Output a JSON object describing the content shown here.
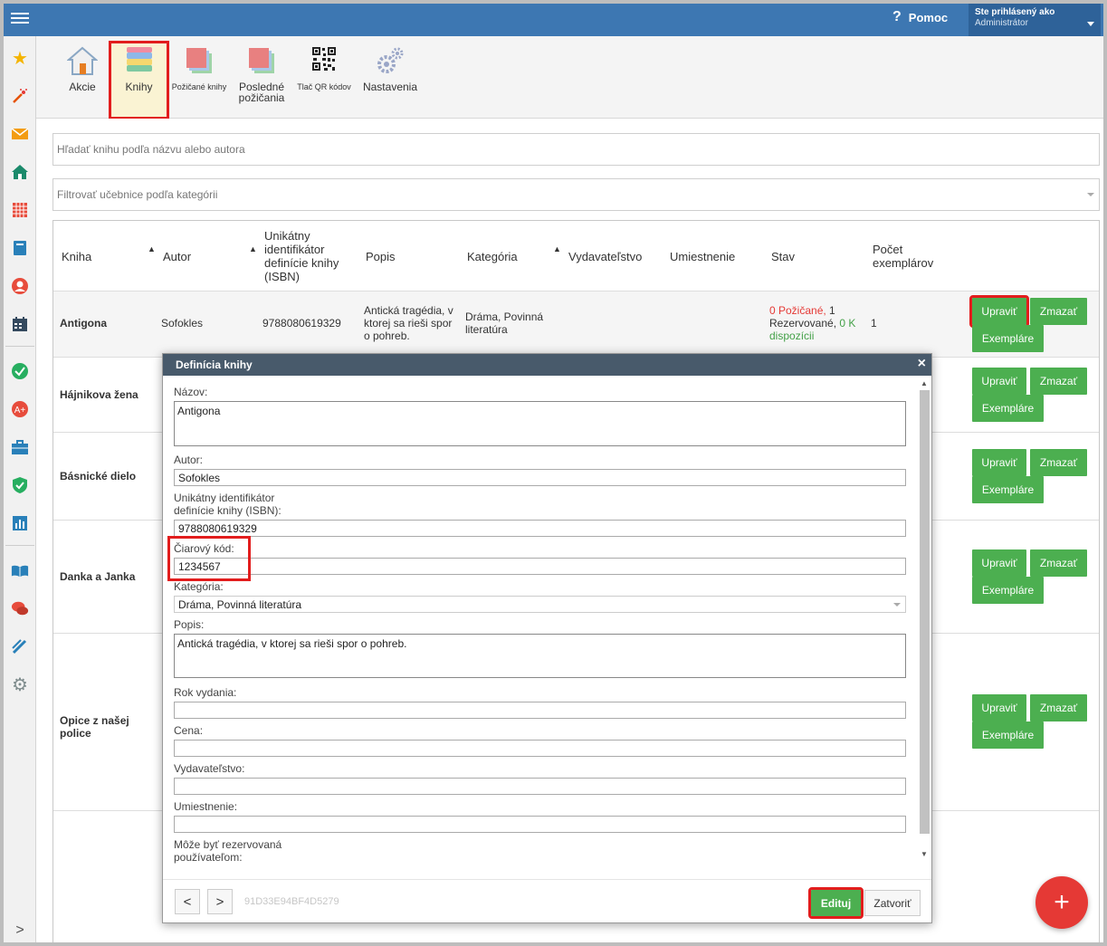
{
  "topbar": {
    "help_label": "Pomoc",
    "help_icon": "?",
    "user_line1": "Ste prihlásený ako",
    "user_line2": "Administrátor"
  },
  "ribbon": [
    {
      "label": "Akcie"
    },
    {
      "label": "Knihy"
    },
    {
      "label": "Požičané knihy"
    },
    {
      "label_line1": "Posledné",
      "label_line2": "požičania"
    },
    {
      "label": "Tlač QR kódov"
    },
    {
      "label": "Nastavenia"
    }
  ],
  "search": {
    "placeholder": "Hľadať knihu podľa názvu alebo autora"
  },
  "category_filter": {
    "placeholder": "Filtrovať učebnice podľa kategórii"
  },
  "table": {
    "headers": {
      "kniha": "Kniha",
      "autor": "Autor",
      "isbn_l1": "Unikátny",
      "isbn_l2": "identifikátor",
      "isbn_l3": "definície knihy",
      "isbn_l4": "(ISBN)",
      "popis": "Popis",
      "kategoria": "Kategória",
      "vydavatelstvo": "Vydavateľstvo",
      "umiestnenie": "Umiestnenie",
      "stav": "Stav",
      "pocet_l1": "Počet",
      "pocet_l2": "exemplárov",
      "sort_icon": "▲"
    },
    "rows": [
      {
        "title": "Antigona",
        "author": "Sofokles",
        "isbn": "9788080619329",
        "desc_l1": "Antická tragédia, v",
        "desc_l2": "ktorej sa rieši spor",
        "desc_l3": "o pohreb.",
        "cat_l1": "Dráma, Povinná",
        "cat_l2": "literatúra",
        "stav_red": "0 Požičané,",
        "stav_n1": " 1",
        "stav_l2": "Rezervované,",
        "stav_green1": " 0 K",
        "stav_green2": "dispozícii",
        "count": "1"
      },
      {
        "title": "Hájnikova žena"
      },
      {
        "title": "Básnické dielo"
      },
      {
        "title": "Danka a Janka"
      },
      {
        "title_l1": "Opice z našej",
        "title_l2": "police"
      }
    ],
    "btn_edit": "Upraviť",
    "btn_delete": "Zmazať",
    "btn_copies": "Exempláre"
  },
  "modal": {
    "title": "Definícia knihy",
    "close": "×",
    "fields": {
      "nazov_label": "Názov:",
      "nazov_value": "Antigona",
      "autor_label": "Autor:",
      "autor_value": "Sofokles",
      "isbn_label_l1": "Unikátny identifikátor",
      "isbn_label_l2": "definície knihy (ISBN):",
      "isbn_value": "9788080619329",
      "barcode_label": "Čiarový kód:",
      "barcode_value": "1234567",
      "kategoria_label": "Kategória:",
      "kategoria_value": "Dráma, Povinná literatúra",
      "popis_label": "Popis:",
      "popis_value": "Antická tragédia, v ktorej sa rieši spor o pohreb.",
      "rok_label": "Rok vydania:",
      "cena_label": "Cena:",
      "vydavatelstvo_label": "Vydavateľstvo:",
      "umiestnenie_label": "Umiestnenie:",
      "rezerv_label_l1": "Môže byť rezervovaná",
      "rezerv_label_l2": "používateľom:"
    },
    "footer": {
      "prev": "<",
      "next": ">",
      "id": "91D33E94BF4D5279",
      "edit": "Edituj",
      "close": "Zatvoriť"
    }
  },
  "fab": "+",
  "sidebar_expand": ">",
  "colors": {
    "topbar": "#3d77b2",
    "green_button": "#4caf50",
    "highlight": "#e21d1d",
    "fab": "#e53935",
    "modal_header": "#485a6b"
  }
}
